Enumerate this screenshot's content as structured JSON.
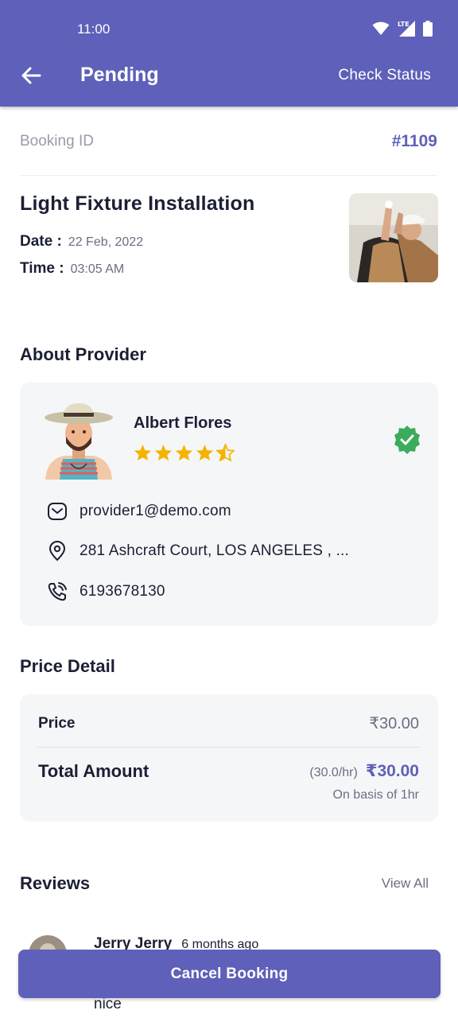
{
  "status_bar": {
    "time": "11:00",
    "network": "LTE"
  },
  "header": {
    "title": "Pending",
    "action_label": "Check Status"
  },
  "booking": {
    "id_label": "Booking ID",
    "id_value": "#1109"
  },
  "service": {
    "name": "Light Fixture Installation",
    "date_label": "Date :",
    "date_value": "22 Feb, 2022",
    "time_label": "Time :",
    "time_value": "03:05 AM"
  },
  "provider": {
    "section_title": "About Provider",
    "name": "Albert Flores",
    "rating": 4.5,
    "email": "provider1@demo.com",
    "address": "281 Ashcraft Court,  LOS ANGELES , ...",
    "phone": "6193678130"
  },
  "price": {
    "section_title": "Price Detail",
    "price_label": "Price",
    "price_value": "₹30.00",
    "total_label": "Total Amount",
    "rate": "(30.0/hr)",
    "total_value": "₹30.00",
    "basis": "On basis of 1hr"
  },
  "reviews": {
    "section_title": "Reviews",
    "view_all": "View All",
    "items": [
      {
        "name": "Jerry Jerry",
        "time": "6 months ago",
        "text": "nice"
      }
    ]
  },
  "actions": {
    "cancel_label": "Cancel Booking"
  },
  "colors": {
    "primary": "#5f60b9",
    "verified": "#3bab5c",
    "star": "#f4b400",
    "card_bg": "#f5f6f8"
  }
}
